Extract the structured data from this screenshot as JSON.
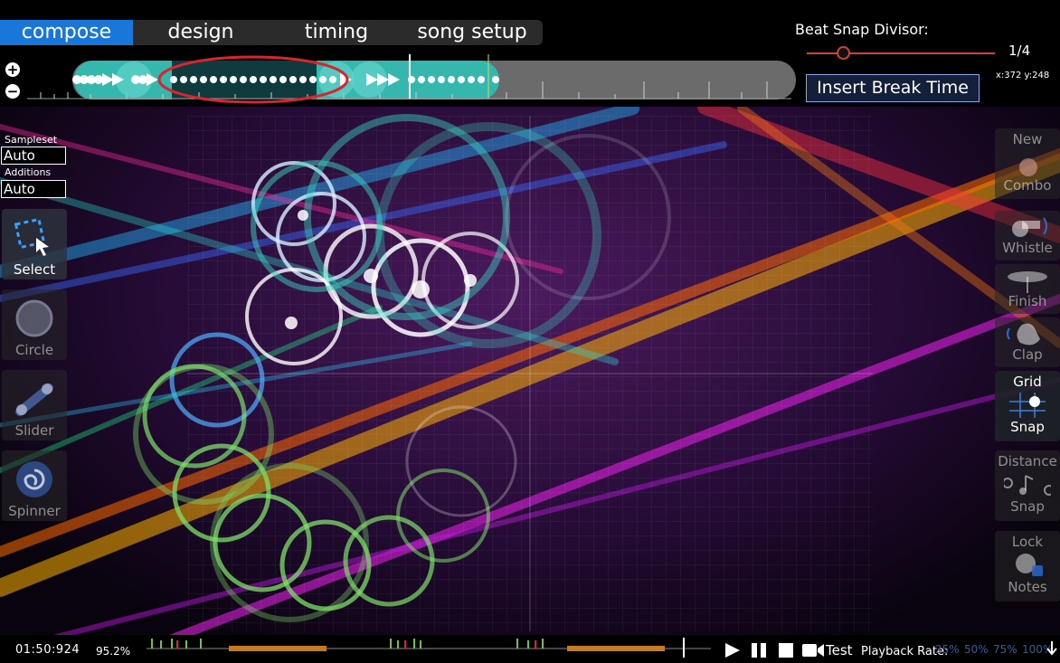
{
  "tabs": [
    {
      "label": "compose",
      "active": true
    },
    {
      "label": "design",
      "active": false
    },
    {
      "label": "timing",
      "active": false
    },
    {
      "label": "song setup",
      "active": false
    }
  ],
  "beat_snap": {
    "label": "Beat Snap Divisor:",
    "value": "1/4",
    "slider_fraction": 0.19
  },
  "coords": "x:372 y:248",
  "insert_break_label": "Insert Break Time",
  "sampleset": {
    "label": "Sampleset",
    "value": "Auto"
  },
  "additions": {
    "label": "Additions",
    "value": "Auto"
  },
  "left_tools": [
    {
      "label": "Select",
      "icon": "select-icon",
      "active": true
    },
    {
      "label": "Circle",
      "icon": "circle-icon",
      "active": false
    },
    {
      "label": "Slider",
      "icon": "slider-icon",
      "active": false
    },
    {
      "label": "Spinner",
      "icon": "spinner-icon",
      "active": false
    }
  ],
  "right_tools": {
    "new_combo": {
      "line1": "New",
      "line2": "Combo"
    },
    "whistle": "Whistle",
    "finish": "Finish",
    "clap": "Clap",
    "grid_snap": {
      "line1": "Grid",
      "line2": "Snap",
      "active": true
    },
    "distance_snap": {
      "line1": "Distance",
      "line2": "Snap"
    },
    "lock_notes": {
      "line1": "Lock",
      "line2": "Notes"
    }
  },
  "playback": {
    "time": "01:50:924",
    "percent": "95.2%",
    "progress_fraction": 0.952,
    "test_label": "Test",
    "rate_label": "Playback Rate:",
    "rates": [
      "25%",
      "50%",
      "75%",
      "100%"
    ]
  },
  "colors": {
    "accent": "#1877d8",
    "timeline_teal": "#36b7ad",
    "highlight_red": "#d8262c",
    "beat_red": "#c8453f"
  }
}
